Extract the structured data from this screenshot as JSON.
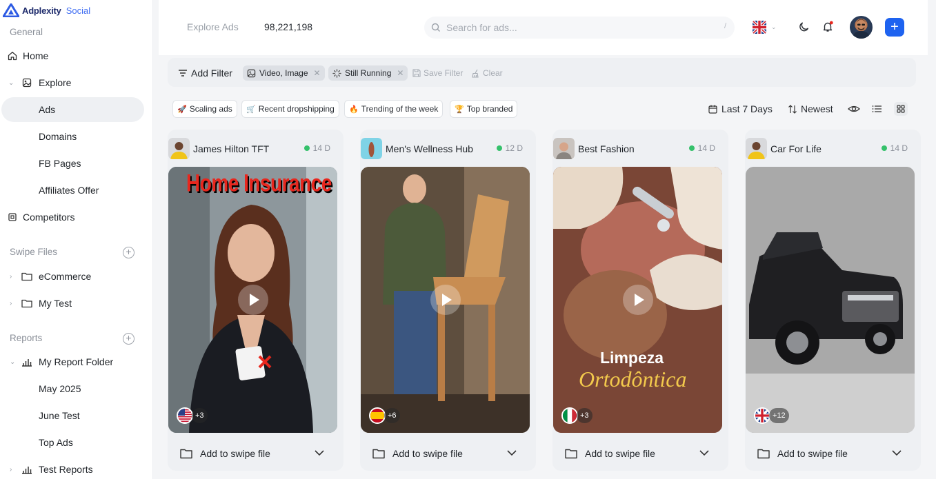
{
  "brand": {
    "name": "Adplexity",
    "product": "Social"
  },
  "sidebar": {
    "general_label": "General",
    "home": "Home",
    "explore": "Explore",
    "explore_items": [
      "Ads",
      "Domains",
      "FB Pages",
      "Affiliates Offer"
    ],
    "competitors": "Competitors",
    "swipe_label": "Swipe Files",
    "swipe_items": [
      "eCommerce",
      "My Test"
    ],
    "reports_label": "Reports",
    "report_folder": "My Report Folder",
    "report_items": [
      "May 2025",
      "June Test",
      "Top Ads"
    ],
    "test_reports": "Test Reports"
  },
  "header": {
    "breadcrumb": "Explore Ads",
    "count": "98,221,198",
    "search_placeholder": "Search for ads...",
    "search_shortcut": "/",
    "plus": "+"
  },
  "filters": {
    "add_filter": "Add Filter",
    "chips": [
      "Video, Image",
      "Still Running"
    ],
    "save": "Save Filter",
    "clear": "Clear"
  },
  "quick_chips": [
    {
      "emoji": "🚀",
      "label": "Scaling ads"
    },
    {
      "emoji": "🛒",
      "label": "Recent dropshipping"
    },
    {
      "emoji": "🔥",
      "label": "Trending of the week"
    },
    {
      "emoji": "🏆",
      "label": "Top branded"
    }
  ],
  "toolbar": {
    "range": "Last 7 Days",
    "sort": "Newest"
  },
  "cards": [
    {
      "name": "James Hilton TFT",
      "age": "14 D",
      "geo_more": "+3",
      "overlay_title": "Home Insurance",
      "swipe": "Add to swipe file"
    },
    {
      "name": "Men's Wellness Hub",
      "age": "12 D",
      "geo_more": "+6",
      "swipe": "Add to swipe file"
    },
    {
      "name": "Best Fashion",
      "age": "14 D",
      "geo_more": "+3",
      "overlay_line1": "Limpeza",
      "overlay_line2": "Ortodôntica",
      "swipe": "Add to swipe file"
    },
    {
      "name": "Car For Life",
      "age": "14 D",
      "geo_more": "+12",
      "swipe": "Add to swipe file"
    }
  ],
  "colors": {
    "accent": "#1e63f0",
    "active_dot": "#35c16b",
    "overlay_red": "#e8271e",
    "overlay_gold": "#f2c94c"
  }
}
